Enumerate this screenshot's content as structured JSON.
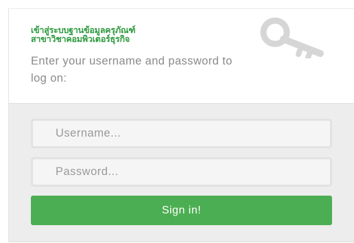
{
  "login": {
    "title_line1": "เข้าสู่ระบบฐานข้อมูลครุภัณฑ์",
    "title_line2": "สาขาวิชาคอมพิวเตอร์ธุรกิจ",
    "instruction": "Enter your username and password to log on:",
    "key_icon": "key-icon",
    "username": {
      "value": "",
      "placeholder": "Username..."
    },
    "password": {
      "value": "",
      "placeholder": "Password..."
    },
    "signin_label": "Sign in!"
  },
  "colors": {
    "accent_green": "#4cae52",
    "title_green": "#2d9a3e",
    "panel_gray": "#ededed",
    "icon_gray": "#d6d6d6"
  }
}
